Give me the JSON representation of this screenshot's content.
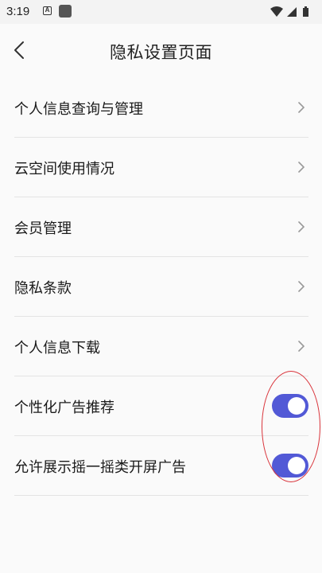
{
  "status_bar": {
    "time": "3:19",
    "notification_icon_letter": "A",
    "icons": [
      "notification-a-icon",
      "app-square-icon",
      "wifi-icon",
      "signal-icon",
      "battery-icon"
    ]
  },
  "header": {
    "title": "隐私设置页面",
    "back_icon": "chevron-left-icon"
  },
  "menu": {
    "items": [
      {
        "label": "个人信息查询与管理",
        "type": "link"
      },
      {
        "label": "云空间使用情况",
        "type": "link"
      },
      {
        "label": "会员管理",
        "type": "link"
      },
      {
        "label": "隐私条款",
        "type": "link"
      },
      {
        "label": "个人信息下载",
        "type": "link"
      },
      {
        "label": "个性化广告推荐",
        "type": "toggle",
        "on": true
      },
      {
        "label": "允许展示摇一摇类开屏广告",
        "type": "toggle",
        "on": true
      }
    ]
  },
  "colors": {
    "toggle_on": "#5259d6",
    "annotation": "#d9333a",
    "divider": "#e3e3e3",
    "background": "#fafafa"
  }
}
